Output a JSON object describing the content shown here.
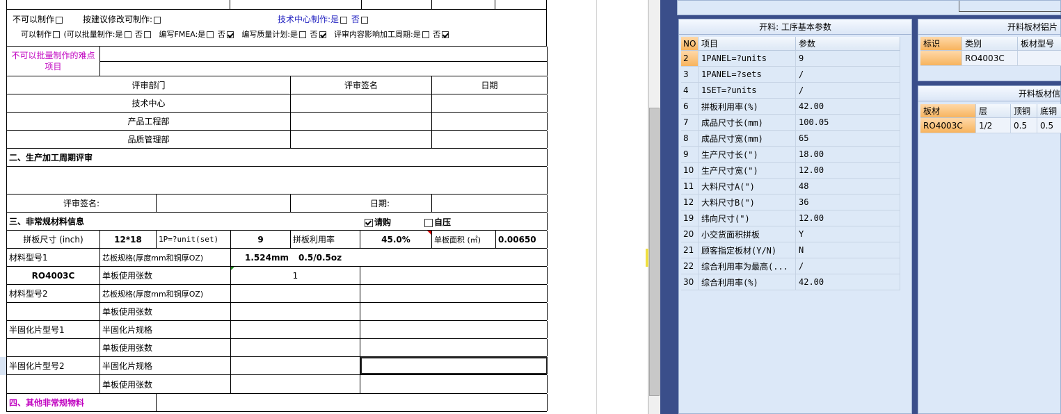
{
  "review_options": {
    "cannot_make": "不可以制作",
    "suggest_modify": "按建议修改可制作:",
    "tech_center_make": "技术中心制作:是",
    "no": "否",
    "can_make": "可以制作",
    "batch_make": "(可以批量制作:是",
    "fmea": "编写FMEA:是",
    "quality_plan": "编写质量计划:是",
    "cycle_impact": "评审内容影响加工周期:是"
  },
  "difficult_items": {
    "label": "不可以批量制作的难点项目"
  },
  "review_table": {
    "headers": [
      "评审部门",
      "评审签名",
      "日期"
    ],
    "departments": [
      "技术中心",
      "产品工程部",
      "品质管理部"
    ]
  },
  "section2": {
    "title": "二、生产加工周期评审",
    "sign_label": "评审签名:",
    "date_label": "日期:"
  },
  "section3": {
    "title": "三、非常规材料信息",
    "purchase": "请购",
    "self_press": "自压",
    "panel_size_label": "拼板尺寸 (inch)",
    "panel_size": "12*18",
    "units_label": "1P=?unit(set)",
    "units": "9",
    "util_label": "拼板利用率",
    "util": "45.0%",
    "area_label": "单板面积 (㎡)",
    "area": "0.00650",
    "mat1_label": "材料型号1",
    "core_spec_label": "芯板规格(厚度mm和铜厚OZ)",
    "core_thickness": "1.524mm",
    "core_copper": "0.5/0.5oz",
    "mat1_value": "RO4003C",
    "sheets_label": "单板使用张数",
    "sheets_value": "1",
    "mat2_label": "材料型号2",
    "pp1_label": "半固化片型号1",
    "pp_spec_label": "半固化片规格",
    "pp2_label": "半固化片型号2"
  },
  "section4": {
    "title": "四、其他非常规物料"
  },
  "panel_params": {
    "title": "开料: 工序基本参数",
    "headers": [
      "NO",
      "项目",
      "参数"
    ],
    "rows": [
      {
        "no": "2",
        "item": "1PANEL=?units",
        "value": "9"
      },
      {
        "no": "3",
        "item": "1PANEL=?sets",
        "value": "/"
      },
      {
        "no": "4",
        "item": "1SET=?units",
        "value": "/"
      },
      {
        "no": "6",
        "item": "拼板利用率(%)",
        "value": "42.00"
      },
      {
        "no": "7",
        "item": "成品尺寸长(mm)",
        "value": "100.05"
      },
      {
        "no": "8",
        "item": "成品尺寸宽(mm)",
        "value": "65"
      },
      {
        "no": "9",
        "item": "生产尺寸长(\")",
        "value": "18.00"
      },
      {
        "no": "10",
        "item": "生产尺寸宽(\")",
        "value": "12.00"
      },
      {
        "no": "11",
        "item": "大料尺寸A(\")",
        "value": "48"
      },
      {
        "no": "12",
        "item": "大料尺寸B(\")",
        "value": "36"
      },
      {
        "no": "19",
        "item": "纬向尺寸(\")",
        "value": "12.00"
      },
      {
        "no": "20",
        "item": "小交货面积拼板",
        "value": "Y"
      },
      {
        "no": "21",
        "item": "顾客指定板材(Y/N)",
        "value": "N"
      },
      {
        "no": "22",
        "item": "综合利用率为最高(...",
        "value": "/"
      },
      {
        "no": "30",
        "item": "综合利用率(%)",
        "value": "42.00"
      }
    ]
  },
  "panel_material": {
    "title": "开料板材铝片",
    "headers": [
      "标识",
      "类别",
      "板材型号"
    ],
    "row": {
      "mark": "",
      "category": "RO4003C",
      "model": ""
    }
  },
  "panel_material2": {
    "title": "开料板材信",
    "headers": [
      "板材",
      "层",
      "顶铜",
      "底铜"
    ],
    "row": {
      "board": "RO4003C",
      "layer": "1/2",
      "top": "0.5",
      "bottom": "0.5"
    }
  }
}
